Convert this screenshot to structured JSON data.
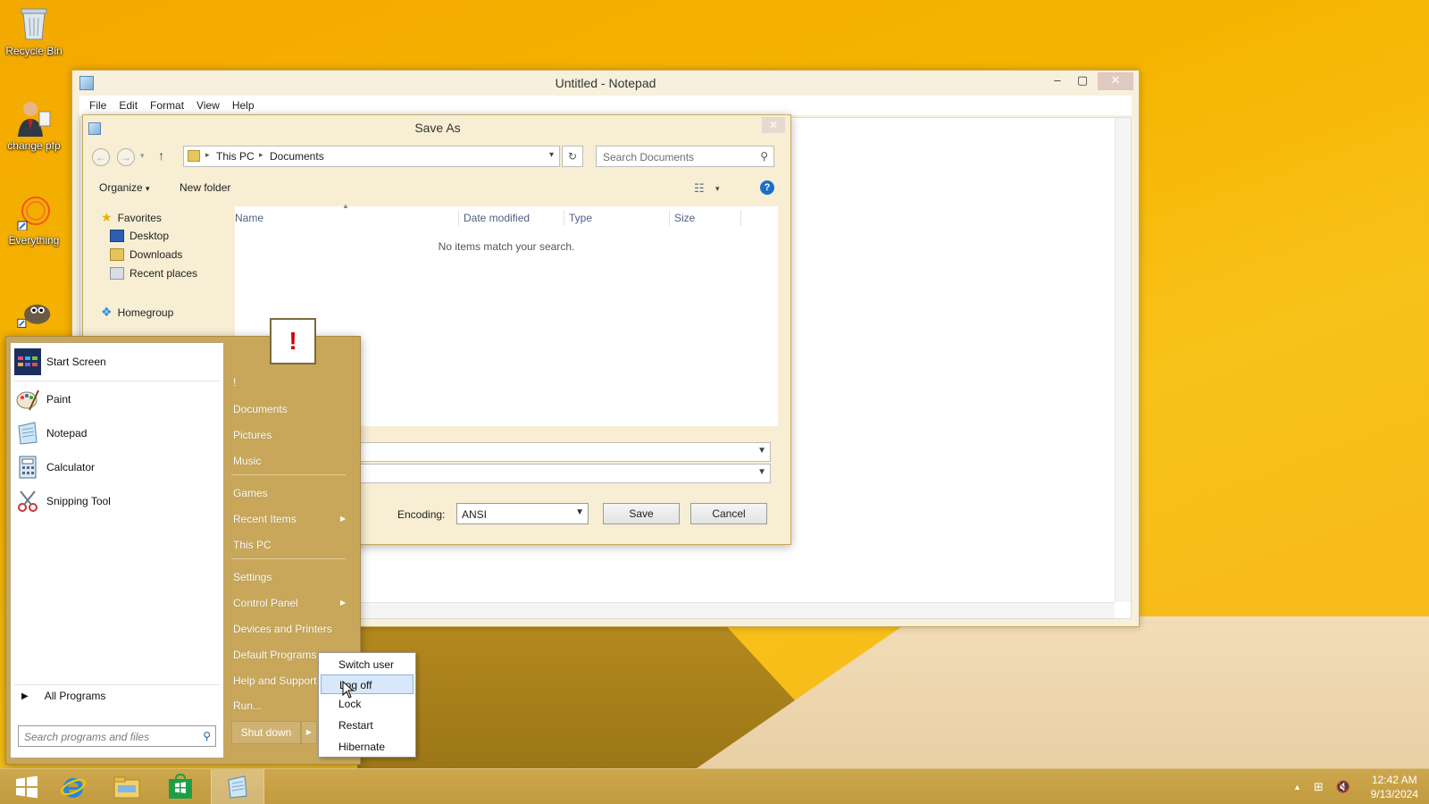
{
  "desktop": {
    "icons": [
      {
        "label": "Recycle Bin",
        "icon": "recycle-bin-icon"
      },
      {
        "label": "change pfp",
        "icon": "user-icon"
      },
      {
        "label": "Everything",
        "icon": "search-ring-icon"
      },
      {
        "label": "",
        "icon": "gimp-icon"
      }
    ]
  },
  "notepad": {
    "title": "Untitled - Notepad",
    "menu": [
      "File",
      "Edit",
      "Format",
      "View",
      "Help"
    ],
    "controls": {
      "minimize": "–",
      "maximize": "▢",
      "close": "✕"
    }
  },
  "save_as": {
    "title": "Save As",
    "breadcrumb": [
      "This PC",
      "Documents"
    ],
    "search_placeholder": "Search Documents",
    "toolbar": {
      "organize": "Organize",
      "new_folder": "New folder",
      "help": "?"
    },
    "nav": {
      "favorites": "Favorites",
      "items": [
        "Desktop",
        "Downloads",
        "Recent places"
      ],
      "homegroup": "Homegroup"
    },
    "columns": [
      "Name",
      "Date modified",
      "Type",
      "Size"
    ],
    "empty_message": "No items match your search.",
    "encoding_label": "Encoding:",
    "encoding_value": "ANSI",
    "save_label": "Save",
    "cancel_label": "Cancel"
  },
  "start_menu": {
    "pinned": [
      {
        "label": "Start Screen",
        "icon": "start-screen-icon"
      },
      {
        "label": "Paint",
        "icon": "paint-icon"
      },
      {
        "label": "Notepad",
        "icon": "notepad-icon"
      },
      {
        "label": "Calculator",
        "icon": "calculator-icon"
      },
      {
        "label": "Snipping Tool",
        "icon": "snipping-tool-icon"
      }
    ],
    "all_programs": "All Programs",
    "search_placeholder": "Search programs and files",
    "user_tile": "!",
    "right": {
      "user": "!",
      "documents": "Documents",
      "pictures": "Pictures",
      "music": "Music",
      "games": "Games",
      "recent_items": "Recent Items",
      "this_pc": "This PC",
      "settings": "Settings",
      "control_panel": "Control Panel",
      "devices": "Devices and Printers",
      "default_programs": "Default Programs",
      "help": "Help and Support",
      "run": "Run..."
    },
    "shutdown_label": "Shut down",
    "shutdown_options": [
      "Switch user",
      "Log off",
      "Lock",
      "Restart",
      "Hibernate"
    ],
    "highlighted_option": "Log off"
  },
  "taskbar": {
    "apps": [
      "start-button",
      "internet-explorer-icon",
      "file-explorer-icon",
      "store-icon",
      "notepad-icon"
    ],
    "clock_time": "12:42 AM",
    "clock_date": "9/13/2024"
  },
  "colors": {
    "accent": "#c8a75a",
    "wallpaper": "#f6b400",
    "highlight": "#d6e8f9"
  }
}
